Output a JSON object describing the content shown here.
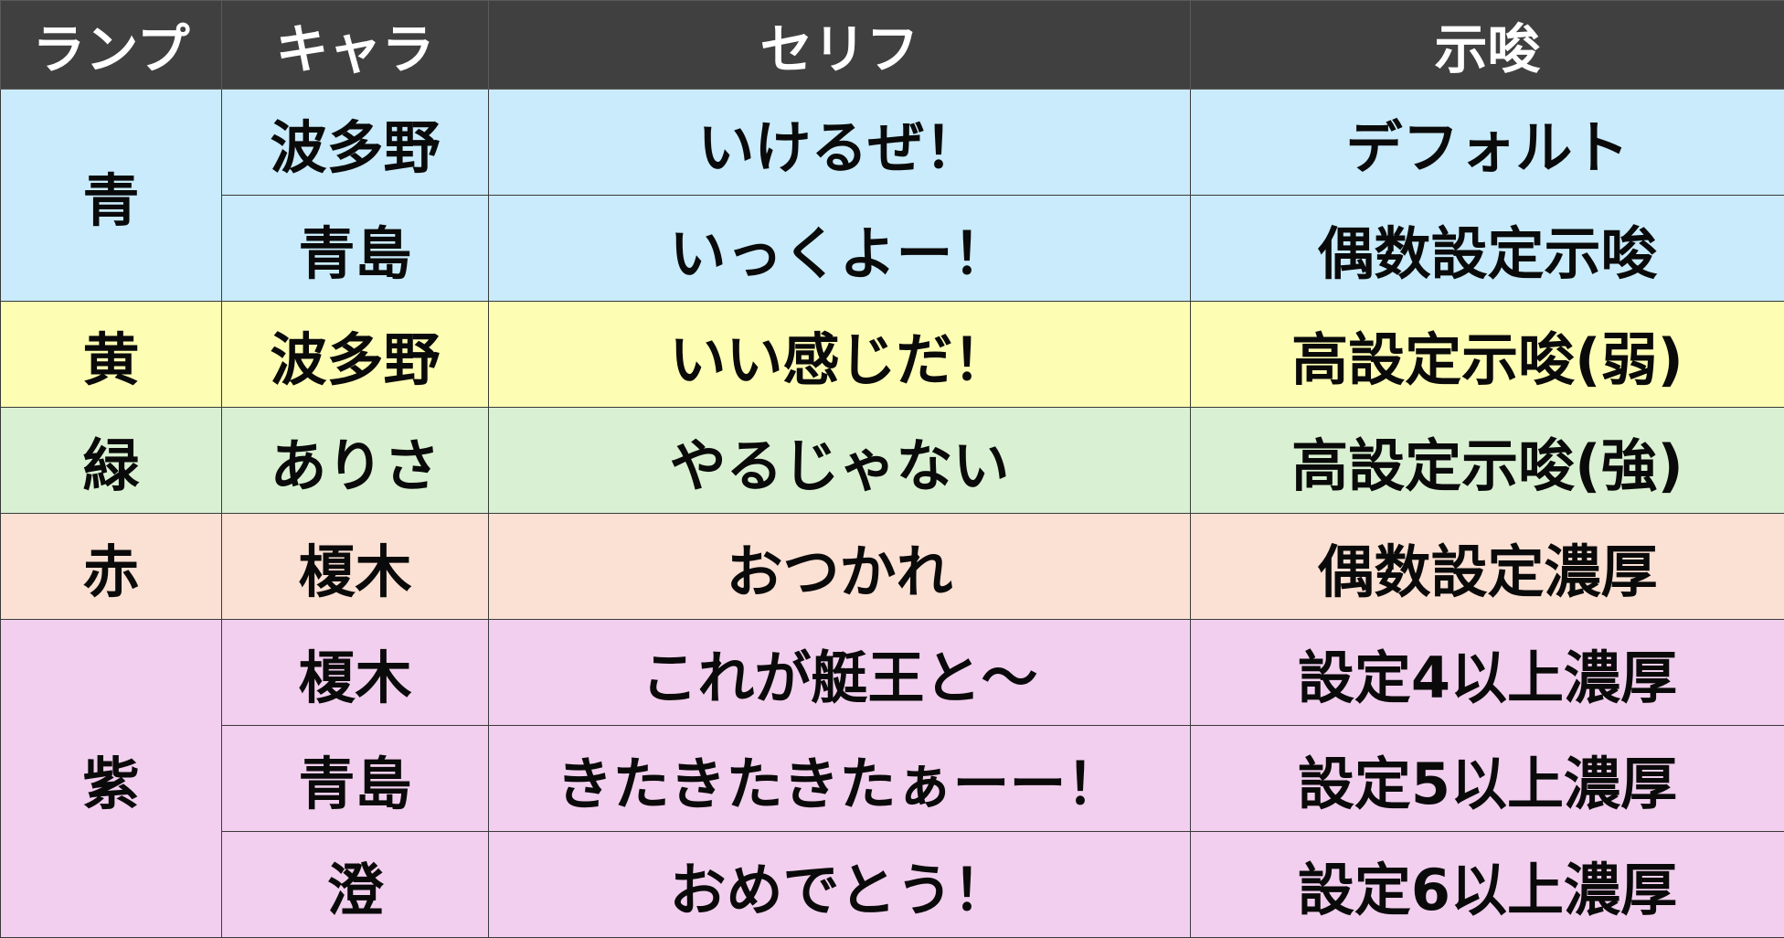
{
  "header": {
    "lamp": "ランプ",
    "chara": "キャラ",
    "serif": "セリフ",
    "hint": "示唆"
  },
  "rows": [
    {
      "lamp": "青",
      "chara": "波多野",
      "serif": "いけるぜ！",
      "hint": "デフォルト",
      "color": "#c9ebfb"
    },
    {
      "chara": "青島",
      "serif": "いっくよー！",
      "hint": "偶数設定示唆"
    },
    {
      "lamp": "黄",
      "chara": "波多野",
      "serif": "いい感じだ！",
      "hint": "高設定示唆(弱)",
      "color": "#fdfdb4"
    },
    {
      "lamp": "緑",
      "chara": "ありさ",
      "serif": "やるじゃない",
      "hint": "高設定示唆(強)",
      "color": "#d9f1d2"
    },
    {
      "lamp": "赤",
      "chara": "榎木",
      "serif": "おつかれ",
      "hint": "偶数設定濃厚",
      "color": "#fbe0d4"
    },
    {
      "lamp": "紫",
      "chara": "榎木",
      "serif": "これが艇王と～",
      "hint": "設定4以上濃厚",
      "color": "#f2cfee"
    },
    {
      "chara": "青島",
      "serif": "きたきたきたぁーー！",
      "hint": "設定5以上濃厚"
    },
    {
      "chara": "澄",
      "serif": "おめでとう！",
      "hint": "設定6以上濃厚"
    }
  ]
}
